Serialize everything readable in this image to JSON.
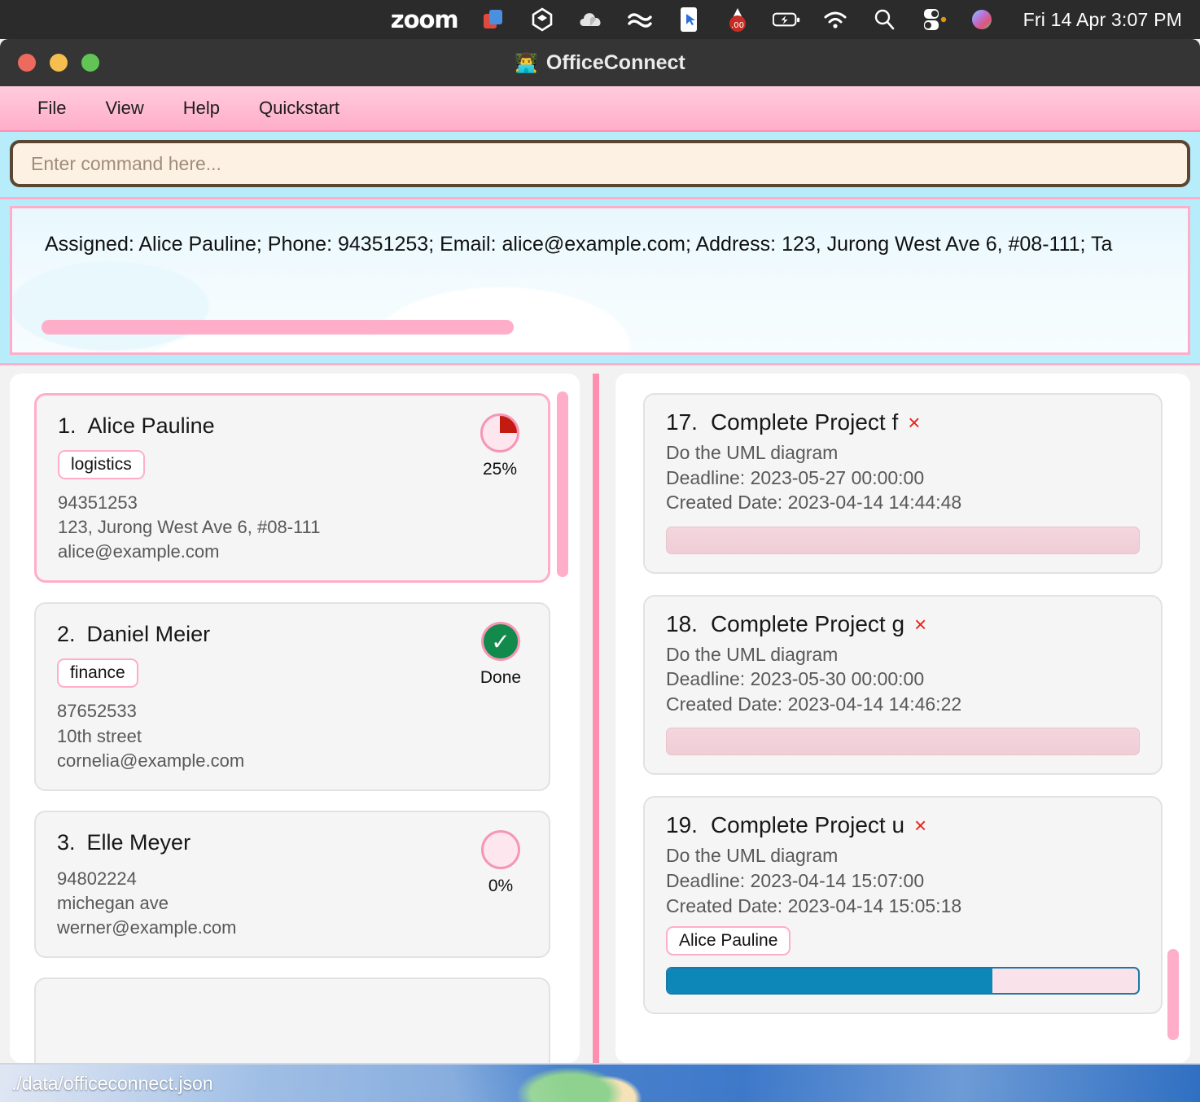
{
  "system_bar": {
    "apps": [
      {
        "name": "zoom-app",
        "label": "zoom"
      },
      {
        "name": "screenshot-icon",
        "label": "▣"
      },
      {
        "name": "unity-icon",
        "label": "◈"
      },
      {
        "name": "cloud-icon",
        "label": "☁"
      },
      {
        "name": "wave-icon",
        "label": "≈"
      },
      {
        "name": "cursor-icon",
        "label": "▯"
      },
      {
        "name": "decibel-meter-icon",
        "label": ".00"
      },
      {
        "name": "battery-icon",
        "label": "⚡"
      },
      {
        "name": "wifi-icon",
        "label": "◠"
      },
      {
        "name": "search-icon",
        "label": "⌕"
      },
      {
        "name": "control-center-icon",
        "label": "⊟"
      },
      {
        "name": "siri-icon",
        "label": "◉"
      }
    ],
    "clock": "Fri 14 Apr  3:07 PM"
  },
  "window": {
    "title": "OfficeConnect",
    "title_emoji": "👨‍💻"
  },
  "menu": {
    "items": [
      {
        "name": "menu-file",
        "label": "File"
      },
      {
        "name": "menu-view",
        "label": "View"
      },
      {
        "name": "menu-help",
        "label": "Help"
      },
      {
        "name": "menu-quickstart",
        "label": "Quickstart"
      }
    ]
  },
  "command": {
    "placeholder": "Enter command here...",
    "value": ""
  },
  "result": {
    "text": "Assigned: Alice Pauline; Phone: 94351253; Email: alice@example.com; Address: 123, Jurong West Ave 6, #08-111; Ta"
  },
  "persons": [
    {
      "index": "1.",
      "name": "Alice Pauline",
      "tags": [
        "logistics"
      ],
      "phone": "94351253",
      "address": "123, Jurong West Ave 6, #08-111",
      "email": "alice@example.com",
      "status_label": "25%",
      "status_kind": "pie25",
      "selected": true
    },
    {
      "index": "2.",
      "name": "Daniel Meier",
      "tags": [
        "finance"
      ],
      "phone": "87652533",
      "address": "10th street",
      "email": "cornelia@example.com",
      "status_label": "Done",
      "status_kind": "done",
      "selected": false
    },
    {
      "index": "3.",
      "name": "Elle Meyer",
      "tags": [],
      "phone": "94802224",
      "address": "michegan ave",
      "email": "werner@example.com",
      "status_label": "0%",
      "status_kind": "pie0",
      "selected": false
    }
  ],
  "tasks": [
    {
      "index": "17.",
      "title": "Complete Project f",
      "delete_glyph": "×",
      "description": "Do the UML diagram",
      "deadline": "Deadline: 2023-05-27 00:00:00",
      "created": "Created Date: 2023-04-14 14:44:48",
      "assignee": "",
      "progress_percent": 0,
      "progress_style": "empty"
    },
    {
      "index": "18.",
      "title": "Complete Project g",
      "delete_glyph": "×",
      "description": "Do the UML diagram",
      "deadline": "Deadline: 2023-05-30 00:00:00",
      "created": "Created Date: 2023-04-14 14:46:22",
      "assignee": "",
      "progress_percent": 0,
      "progress_style": "empty"
    },
    {
      "index": "19.",
      "title": "Complete Project u",
      "delete_glyph": "×",
      "description": "Do the UML diagram",
      "deadline": "Deadline: 2023-04-14 15:07:00",
      "created": "Created Date: 2023-04-14 15:05:18",
      "assignee": "Alice Pauline",
      "progress_percent": 69,
      "progress_style": "filled"
    }
  ],
  "status_bar": {
    "file_path": "./data/officeconnect.json"
  },
  "colors": {
    "accent_pink": "#ffaec9",
    "accent_pink_dark": "#ff8fb1",
    "sky_blue": "#b7ecfb",
    "cream": "#fdf1e3",
    "brown_border": "#5a4632",
    "progress_blue": "#0d86b8",
    "done_green": "#128a4c",
    "delete_red": "#e8221c",
    "pie_red": "#c31b12"
  }
}
